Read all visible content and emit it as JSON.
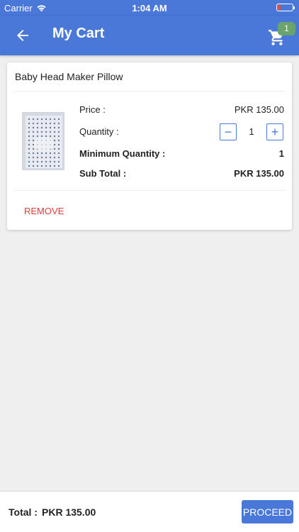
{
  "status_bar": {
    "carrier": "Carrier",
    "time": "1:04 AM",
    "wifi_icon": "wifi-icon",
    "battery_icon": "battery-icon"
  },
  "header": {
    "title": "My Cart",
    "back_icon": "arrow-left-icon",
    "cart_icon": "shopping-cart-icon",
    "cart_count": "1"
  },
  "cart": {
    "items": [
      {
        "name": "Baby Head Maker Pillow",
        "price_label": "Price :",
        "price_value": "PKR 135.00",
        "quantity_label": "Quantity :",
        "quantity_value": "1",
        "decrement_label": "−",
        "increment_label": "+",
        "min_qty_label": "Minimum Quantity :",
        "min_qty_value": "1",
        "subtotal_label": "Sub Total :",
        "subtotal_value": "PKR 135.00",
        "remove_label": "REMOVE"
      }
    ]
  },
  "footer": {
    "total_label": "Total :",
    "total_value": "PKR 135.00",
    "proceed_label": "PROCEED"
  },
  "colors": {
    "primary": "#4a78d8",
    "badge": "#6aa36c",
    "danger": "#e23b3b",
    "background": "#efefef"
  }
}
